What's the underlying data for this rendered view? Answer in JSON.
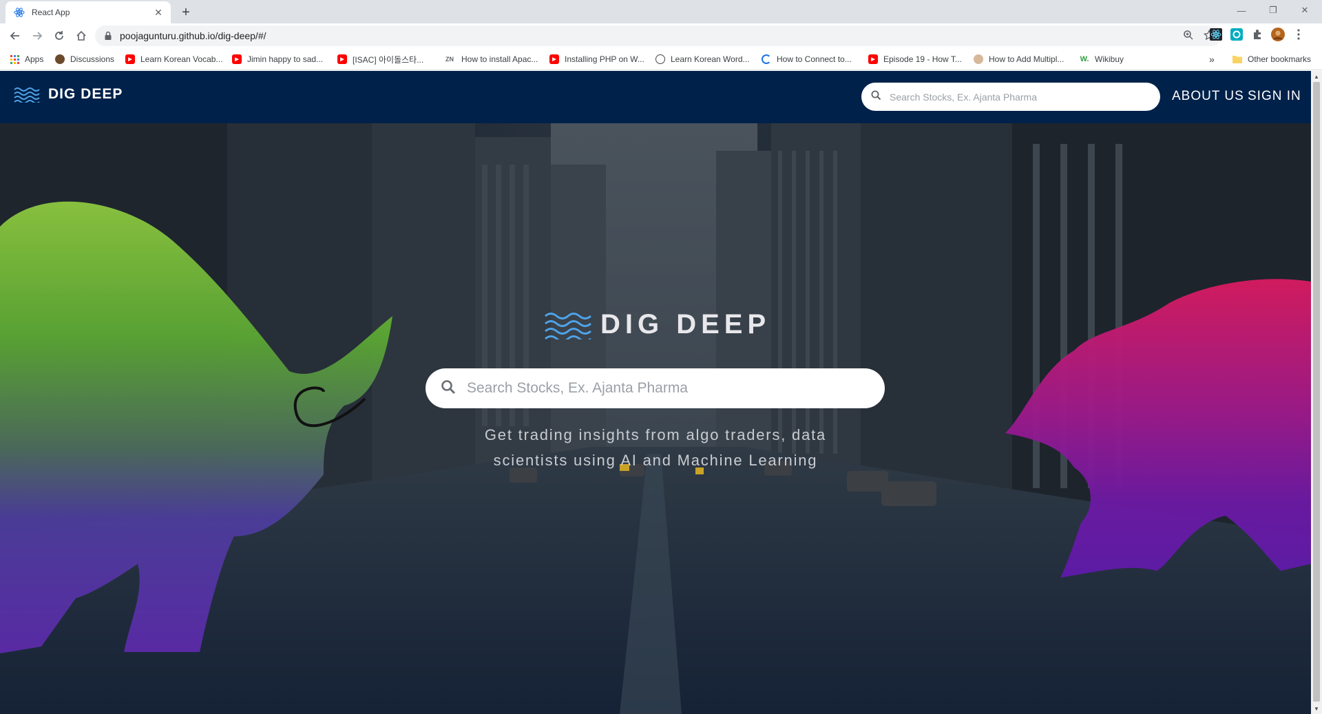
{
  "browser": {
    "tab_title": "React App",
    "url": "poojagunturu.github.io/dig-deep/#/",
    "bookmarks": [
      {
        "label": "Apps",
        "icon": "apps-grid-icon"
      },
      {
        "label": "Discussions",
        "icon": "discussions-icon"
      },
      {
        "label": "Learn Korean Vocab...",
        "icon": "youtube-icon"
      },
      {
        "label": "Jimin happy to sad...",
        "icon": "youtube-icon"
      },
      {
        "label": "[ISAC] 아이돌스타...",
        "icon": "youtube-icon"
      },
      {
        "label": "How to install Apac...",
        "icon": "zn-icon"
      },
      {
        "label": "Installing PHP on W...",
        "icon": "youtube-icon"
      },
      {
        "label": "Learn Korean Word...",
        "icon": "wordpress-icon"
      },
      {
        "label": "How to Connect to...",
        "icon": "sync-icon"
      },
      {
        "label": "Episode 19 - How T...",
        "icon": "youtube-icon"
      },
      {
        "label": "How to Add Multipl...",
        "icon": "site-icon"
      },
      {
        "label": "Wikibuy",
        "icon": "wikibuy-icon"
      }
    ],
    "other_bookmarks": "Other bookmarks",
    "overflow": "»"
  },
  "site": {
    "brand": "DIG DEEP",
    "top_search_placeholder": "Search Stocks, Ex. Ajanta Pharma",
    "nav": {
      "about": "ABOUT US",
      "signin": "SIGN IN"
    },
    "hero": {
      "title": "DIG DEEP",
      "search_placeholder": "Search Stocks, Ex. Ajanta Pharma",
      "tagline": "Get trading insights from algo traders, data scientists using AI and Machine Learning"
    }
  },
  "colors": {
    "nav_bg": "#00214a",
    "bull_top": "#8cc63f",
    "bull_bottom": "#5b2aa8",
    "bear_top": "#d81b60",
    "bear_bottom": "#5e1aa8"
  }
}
